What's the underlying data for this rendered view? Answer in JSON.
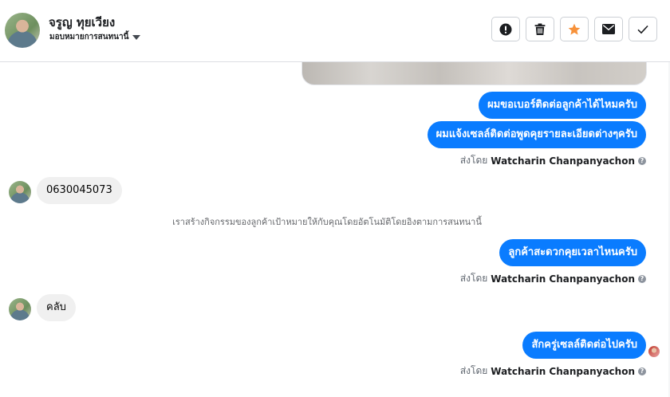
{
  "header": {
    "contact_name": "จรูญ ทุยเวียง",
    "assign_label": "มอบหมายการสนทนานี้",
    "actions": [
      {
        "name": "spam-button",
        "icon": "alert-icon"
      },
      {
        "name": "delete-button",
        "icon": "trash-icon"
      },
      {
        "name": "star-button",
        "icon": "star-icon",
        "color": "#f7923b"
      },
      {
        "name": "mark-unread-button",
        "icon": "envelope-icon"
      },
      {
        "name": "mark-done-button",
        "icon": "check-icon"
      }
    ]
  },
  "messages": {
    "out_1": "ผมขอเบอร์ติดต่อลูกค้าได้ไหมครับ",
    "out_2": "ผมแจ้งเซลล์ติดต่อพูดคุยรายละเอียดต่างๆครับ",
    "in_1": "0630045073",
    "system_note": "เราสร้างกิจกรรมของลูกค้าเป้าหมายให้กับคุณโดยอัตโนมัติโดยอิงตามการสนทนานี้",
    "out_3": "ลูกค้าสะดวกคุยเวลาไหนครับ",
    "in_2": "คลับ",
    "out_4": "สักครู่เซลล์ติดต่อไปครับ"
  },
  "sent_by": {
    "prefix": "ส่งโดย",
    "agent_name": "Watcharin Chanpanyachon",
    "help_glyph": "?"
  },
  "colors": {
    "outgoing_bubble": "#0a7cff",
    "incoming_bubble": "#f0f0f0",
    "star_accent": "#f7923b"
  }
}
